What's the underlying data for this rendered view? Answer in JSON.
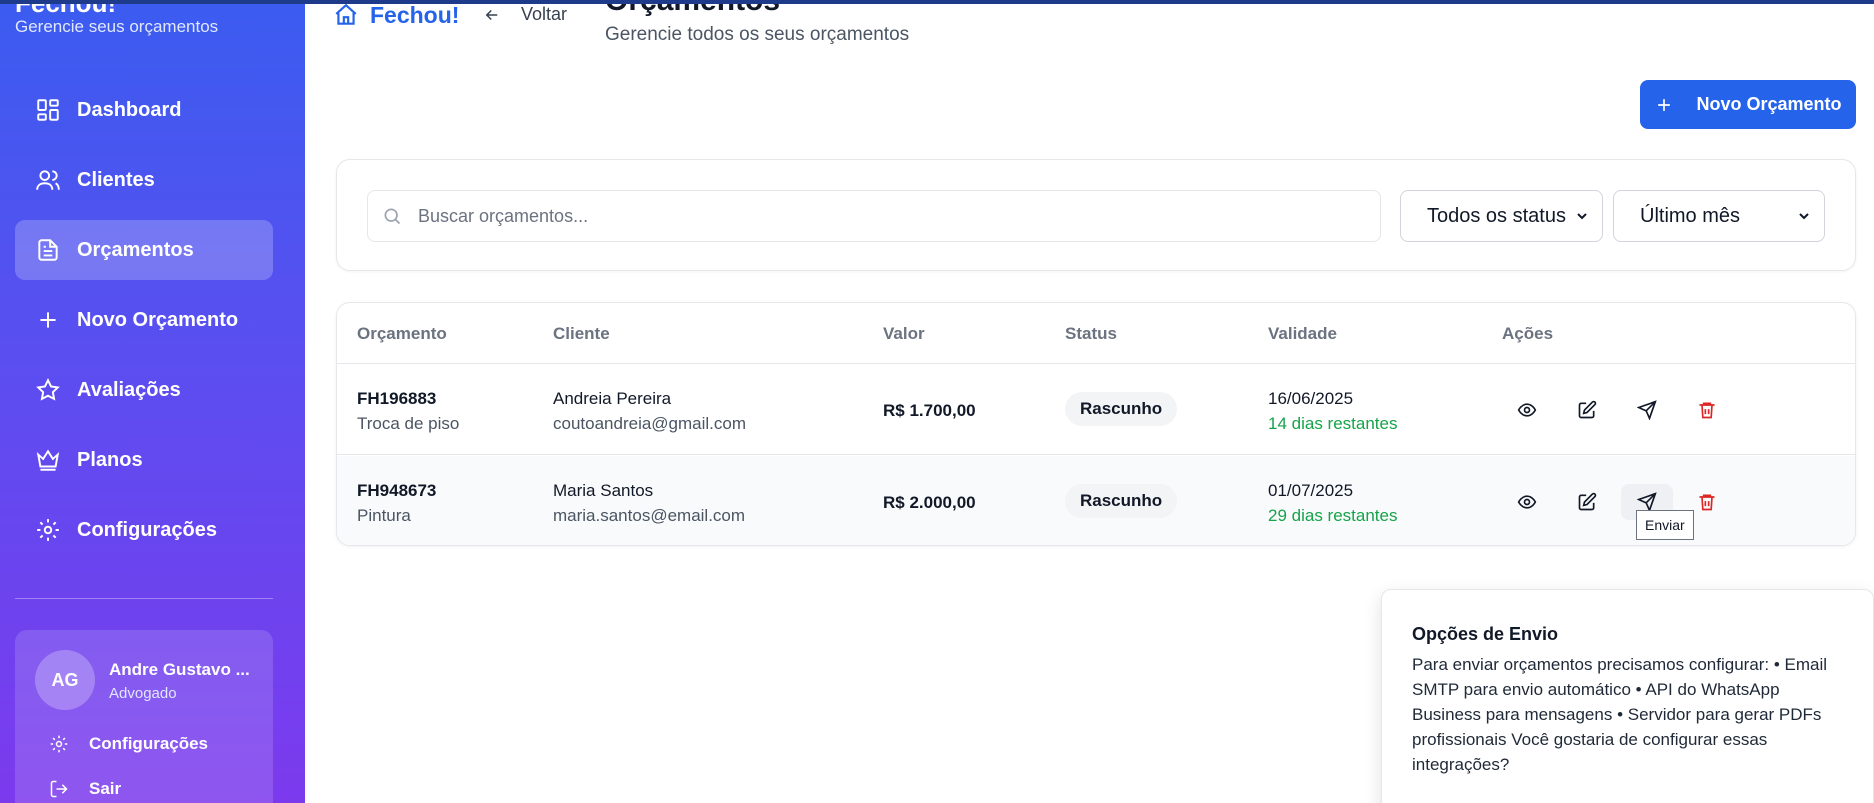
{
  "sidebar": {
    "brand": "Fechou!",
    "subtitle": "Gerencie seus orçamentos",
    "items": [
      {
        "label": "Dashboard",
        "icon": "dashboard-icon"
      },
      {
        "label": "Clientes",
        "icon": "users-icon"
      },
      {
        "label": "Orçamentos",
        "icon": "file-text-icon",
        "active": true
      },
      {
        "label": "Novo Orçamento",
        "icon": "plus-icon"
      },
      {
        "label": "Avaliações",
        "icon": "star-icon"
      },
      {
        "label": "Planos",
        "icon": "crown-icon"
      },
      {
        "label": "Configurações",
        "icon": "gear-icon"
      }
    ],
    "user": {
      "initials": "AG",
      "name": "Andre Gustavo ...",
      "role": "Advogado",
      "settings_label": "Configurações",
      "logout_label": "Sair"
    }
  },
  "header": {
    "logo": "Fechou!",
    "back_label": "Voltar",
    "title": "Orçamentos",
    "subtitle": "Gerencie todos os seus orçamentos",
    "new_button_label": "Novo Orçamento"
  },
  "filters": {
    "search_placeholder": "Buscar orçamentos...",
    "status_selected": "Todos os status",
    "period_selected": "Último mês"
  },
  "table": {
    "columns": [
      "Orçamento",
      "Cliente",
      "Valor",
      "Status",
      "Validade",
      "Ações"
    ],
    "rows": [
      {
        "code": "FH196883",
        "service": "Troca de piso",
        "client": "Andreia Pereira",
        "email": "coutoandreia@gmail.com",
        "value": "R$ 1.700,00",
        "status": "Rascunho",
        "date": "16/06/2025",
        "remaining": "14 dias restantes"
      },
      {
        "code": "FH948673",
        "service": "Pintura",
        "client": "Maria Santos",
        "email": "maria.santos@email.com",
        "value": "R$ 2.000,00",
        "status": "Rascunho",
        "date": "01/07/2025",
        "remaining": "29 dias restantes"
      }
    ]
  },
  "tooltip": "Enviar",
  "popup": {
    "title": "Opções de Envio",
    "body": "Para enviar orçamentos precisamos configurar: • Email SMTP para envio automático • API do WhatsApp Business para mensagens • Servidor para gerar PDFs profissionais Você gostaria de configurar essas integrações?"
  },
  "colors": {
    "accent": "#2563eb",
    "delete": "#dc2626",
    "remaining": "#16a34a"
  }
}
